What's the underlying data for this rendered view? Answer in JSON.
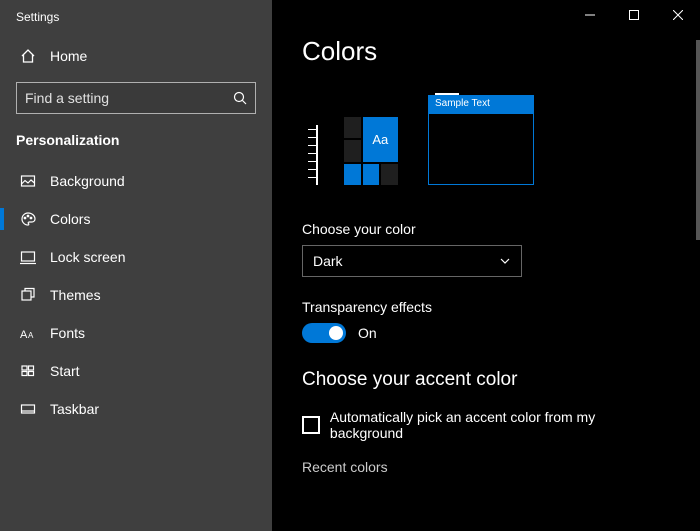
{
  "window": {
    "title": "Settings"
  },
  "home": {
    "label": "Home"
  },
  "search": {
    "placeholder": "Find a setting"
  },
  "section": {
    "head": "Personalization"
  },
  "nav": {
    "background": "Background",
    "colors": "Colors",
    "lock": "Lock screen",
    "themes": "Themes",
    "fonts": "Fonts",
    "start": "Start",
    "taskbar": "Taskbar"
  },
  "page": {
    "title": "Colors",
    "preview_aa": "Aa",
    "preview_window_title": "Sample Text",
    "color_mode_label": "Choose your color",
    "color_mode_value": "Dark",
    "transparency_label": "Transparency effects",
    "transparency_state": "On",
    "accent_heading": "Choose your accent color",
    "auto_accent": "Automatically pick an accent color from my background",
    "recent_heading": "Recent colors"
  },
  "colors": {
    "accent": "#0078d7"
  }
}
